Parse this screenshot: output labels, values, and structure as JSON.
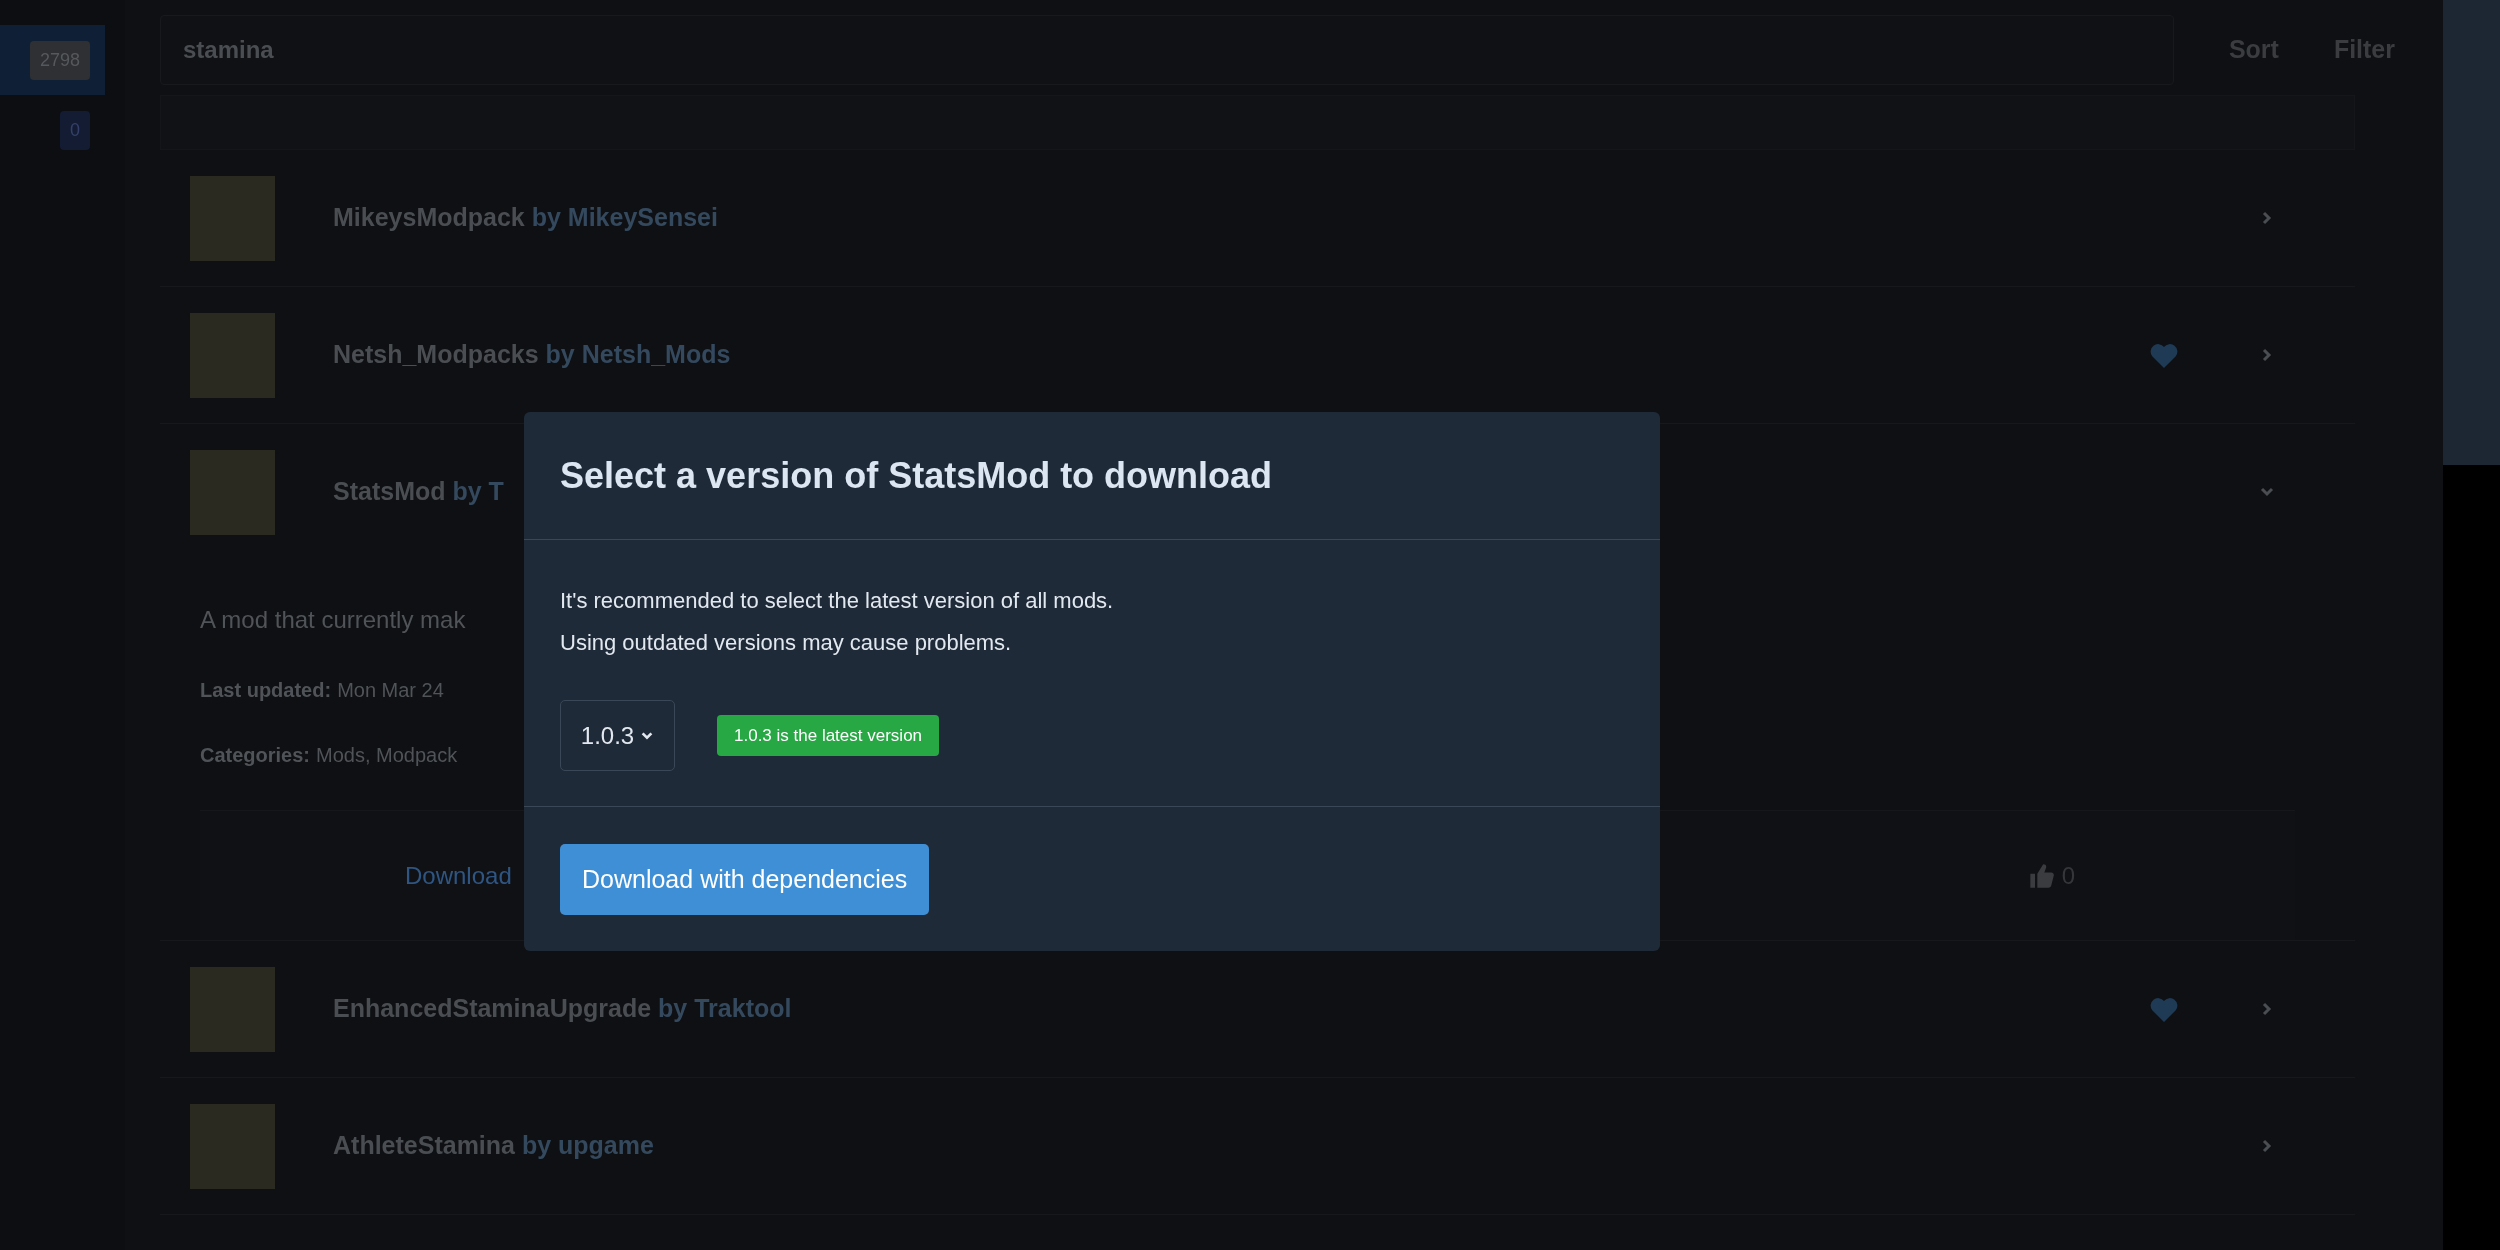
{
  "sidebar": {
    "badges": [
      {
        "label": "2798",
        "selected": true
      },
      {
        "label": "0",
        "selected": false
      }
    ]
  },
  "search": {
    "value": "stamina"
  },
  "toolbar": [
    "Sort",
    "Filter"
  ],
  "mods": [
    {
      "name": "MikeysModpack",
      "author": "by MikeySensei",
      "favorite": false,
      "expanded": false
    },
    {
      "name": "Netsh_Modpacks",
      "author": "by Netsh_Mods",
      "favorite": true,
      "expanded": false
    },
    {
      "name": "StatsMod",
      "author": "by T",
      "favorite": false,
      "expanded": true,
      "details": {
        "description": "A mod that currently mak",
        "last_updated_label": "Last updated:",
        "last_updated": "Mon Mar 24",
        "categories_label": "Categories:",
        "categories": "Mods, Modpack",
        "download": "Download",
        "likes": "0"
      }
    },
    {
      "name": "EnhancedStaminaUpgrade",
      "author": "by Traktool",
      "favorite": true,
      "expanded": false
    },
    {
      "name": "AthleteStamina",
      "author": "by upgame",
      "favorite": false,
      "expanded": false
    }
  ],
  "dialog": {
    "title": "Select a version of StatsMod to download",
    "message": [
      "It's recommended to select the latest version of all mods.",
      "Using outdated versions may cause problems."
    ],
    "version_select": {
      "value": "1.0.3"
    },
    "latest_badge": "1.0.3 is the latest version",
    "button": "Download with dependencies"
  }
}
